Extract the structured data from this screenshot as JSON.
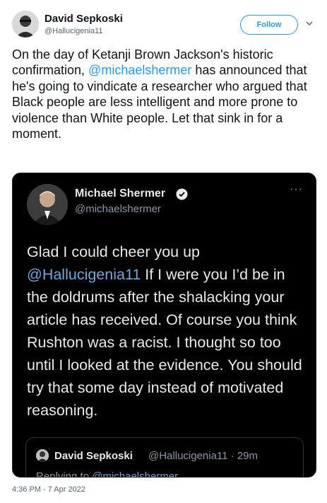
{
  "author": {
    "name": "David Sepkoski",
    "handle": "@Hallucigenia11"
  },
  "follow_label": "Follow",
  "tweet": {
    "text_1": "On the day of Ketanji Brown Jackson's historic confirmation, ",
    "mention": "@michaelshermer",
    "text_2": " has announced that he's going to vindicate a researcher who argued that Black people are less intelligent and more prone to violence than White people. Let that sink in for a moment."
  },
  "embedded": {
    "name": "Michael Shermer",
    "handle": "@michaelshermer",
    "more": "···",
    "text_1": "Glad I could cheer you up ",
    "mention": "@Hallucigenia11",
    "text_2": " If I were you I’d be in the doldrums after the shalacking your article has received. Of course you think Rushton was a racist. I thought so too until I looked at the evidence. You should try that some day instead of motivated reasoning.",
    "quote": {
      "name": "David Sepkoski",
      "handle_time": "@Hallucigenia11 · 29m",
      "replying_label": "Replying to ",
      "replying_mention": "@michaelshermer"
    }
  },
  "timestamp": "4:36 PM - 7 Apr 2022",
  "colors": {
    "accent": "#1d9bf0",
    "dark_card": "#000000",
    "dark_text": "#e7e9ea",
    "dark_muted": "#8b98a5"
  }
}
